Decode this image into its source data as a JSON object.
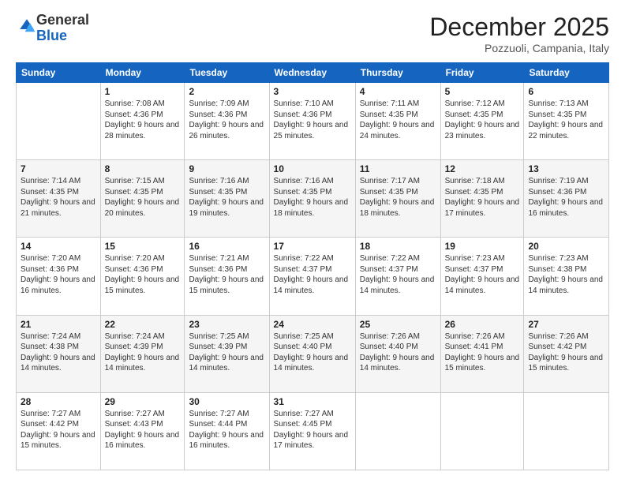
{
  "logo": {
    "general": "General",
    "blue": "Blue"
  },
  "header": {
    "month": "December 2025",
    "location": "Pozzuoli, Campania, Italy"
  },
  "days_of_week": [
    "Sunday",
    "Monday",
    "Tuesday",
    "Wednesday",
    "Thursday",
    "Friday",
    "Saturday"
  ],
  "weeks": [
    [
      {
        "day": "",
        "sunrise": "",
        "sunset": "",
        "daylight": "",
        "empty": true
      },
      {
        "day": "1",
        "sunrise": "Sunrise: 7:08 AM",
        "sunset": "Sunset: 4:36 PM",
        "daylight": "Daylight: 9 hours and 28 minutes."
      },
      {
        "day": "2",
        "sunrise": "Sunrise: 7:09 AM",
        "sunset": "Sunset: 4:36 PM",
        "daylight": "Daylight: 9 hours and 26 minutes."
      },
      {
        "day": "3",
        "sunrise": "Sunrise: 7:10 AM",
        "sunset": "Sunset: 4:36 PM",
        "daylight": "Daylight: 9 hours and 25 minutes."
      },
      {
        "day": "4",
        "sunrise": "Sunrise: 7:11 AM",
        "sunset": "Sunset: 4:35 PM",
        "daylight": "Daylight: 9 hours and 24 minutes."
      },
      {
        "day": "5",
        "sunrise": "Sunrise: 7:12 AM",
        "sunset": "Sunset: 4:35 PM",
        "daylight": "Daylight: 9 hours and 23 minutes."
      },
      {
        "day": "6",
        "sunrise": "Sunrise: 7:13 AM",
        "sunset": "Sunset: 4:35 PM",
        "daylight": "Daylight: 9 hours and 22 minutes."
      }
    ],
    [
      {
        "day": "7",
        "sunrise": "Sunrise: 7:14 AM",
        "sunset": "Sunset: 4:35 PM",
        "daylight": "Daylight: 9 hours and 21 minutes."
      },
      {
        "day": "8",
        "sunrise": "Sunrise: 7:15 AM",
        "sunset": "Sunset: 4:35 PM",
        "daylight": "Daylight: 9 hours and 20 minutes."
      },
      {
        "day": "9",
        "sunrise": "Sunrise: 7:16 AM",
        "sunset": "Sunset: 4:35 PM",
        "daylight": "Daylight: 9 hours and 19 minutes."
      },
      {
        "day": "10",
        "sunrise": "Sunrise: 7:16 AM",
        "sunset": "Sunset: 4:35 PM",
        "daylight": "Daylight: 9 hours and 18 minutes."
      },
      {
        "day": "11",
        "sunrise": "Sunrise: 7:17 AM",
        "sunset": "Sunset: 4:35 PM",
        "daylight": "Daylight: 9 hours and 18 minutes."
      },
      {
        "day": "12",
        "sunrise": "Sunrise: 7:18 AM",
        "sunset": "Sunset: 4:35 PM",
        "daylight": "Daylight: 9 hours and 17 minutes."
      },
      {
        "day": "13",
        "sunrise": "Sunrise: 7:19 AM",
        "sunset": "Sunset: 4:36 PM",
        "daylight": "Daylight: 9 hours and 16 minutes."
      }
    ],
    [
      {
        "day": "14",
        "sunrise": "Sunrise: 7:20 AM",
        "sunset": "Sunset: 4:36 PM",
        "daylight": "Daylight: 9 hours and 16 minutes."
      },
      {
        "day": "15",
        "sunrise": "Sunrise: 7:20 AM",
        "sunset": "Sunset: 4:36 PM",
        "daylight": "Daylight: 9 hours and 15 minutes."
      },
      {
        "day": "16",
        "sunrise": "Sunrise: 7:21 AM",
        "sunset": "Sunset: 4:36 PM",
        "daylight": "Daylight: 9 hours and 15 minutes."
      },
      {
        "day": "17",
        "sunrise": "Sunrise: 7:22 AM",
        "sunset": "Sunset: 4:37 PM",
        "daylight": "Daylight: 9 hours and 14 minutes."
      },
      {
        "day": "18",
        "sunrise": "Sunrise: 7:22 AM",
        "sunset": "Sunset: 4:37 PM",
        "daylight": "Daylight: 9 hours and 14 minutes."
      },
      {
        "day": "19",
        "sunrise": "Sunrise: 7:23 AM",
        "sunset": "Sunset: 4:37 PM",
        "daylight": "Daylight: 9 hours and 14 minutes."
      },
      {
        "day": "20",
        "sunrise": "Sunrise: 7:23 AM",
        "sunset": "Sunset: 4:38 PM",
        "daylight": "Daylight: 9 hours and 14 minutes."
      }
    ],
    [
      {
        "day": "21",
        "sunrise": "Sunrise: 7:24 AM",
        "sunset": "Sunset: 4:38 PM",
        "daylight": "Daylight: 9 hours and 14 minutes."
      },
      {
        "day": "22",
        "sunrise": "Sunrise: 7:24 AM",
        "sunset": "Sunset: 4:39 PM",
        "daylight": "Daylight: 9 hours and 14 minutes."
      },
      {
        "day": "23",
        "sunrise": "Sunrise: 7:25 AM",
        "sunset": "Sunset: 4:39 PM",
        "daylight": "Daylight: 9 hours and 14 minutes."
      },
      {
        "day": "24",
        "sunrise": "Sunrise: 7:25 AM",
        "sunset": "Sunset: 4:40 PM",
        "daylight": "Daylight: 9 hours and 14 minutes."
      },
      {
        "day": "25",
        "sunrise": "Sunrise: 7:26 AM",
        "sunset": "Sunset: 4:40 PM",
        "daylight": "Daylight: 9 hours and 14 minutes."
      },
      {
        "day": "26",
        "sunrise": "Sunrise: 7:26 AM",
        "sunset": "Sunset: 4:41 PM",
        "daylight": "Daylight: 9 hours and 15 minutes."
      },
      {
        "day": "27",
        "sunrise": "Sunrise: 7:26 AM",
        "sunset": "Sunset: 4:42 PM",
        "daylight": "Daylight: 9 hours and 15 minutes."
      }
    ],
    [
      {
        "day": "28",
        "sunrise": "Sunrise: 7:27 AM",
        "sunset": "Sunset: 4:42 PM",
        "daylight": "Daylight: 9 hours and 15 minutes."
      },
      {
        "day": "29",
        "sunrise": "Sunrise: 7:27 AM",
        "sunset": "Sunset: 4:43 PM",
        "daylight": "Daylight: 9 hours and 16 minutes."
      },
      {
        "day": "30",
        "sunrise": "Sunrise: 7:27 AM",
        "sunset": "Sunset: 4:44 PM",
        "daylight": "Daylight: 9 hours and 16 minutes."
      },
      {
        "day": "31",
        "sunrise": "Sunrise: 7:27 AM",
        "sunset": "Sunset: 4:45 PM",
        "daylight": "Daylight: 9 hours and 17 minutes."
      },
      {
        "day": "",
        "empty": true
      },
      {
        "day": "",
        "empty": true
      },
      {
        "day": "",
        "empty": true
      }
    ]
  ]
}
